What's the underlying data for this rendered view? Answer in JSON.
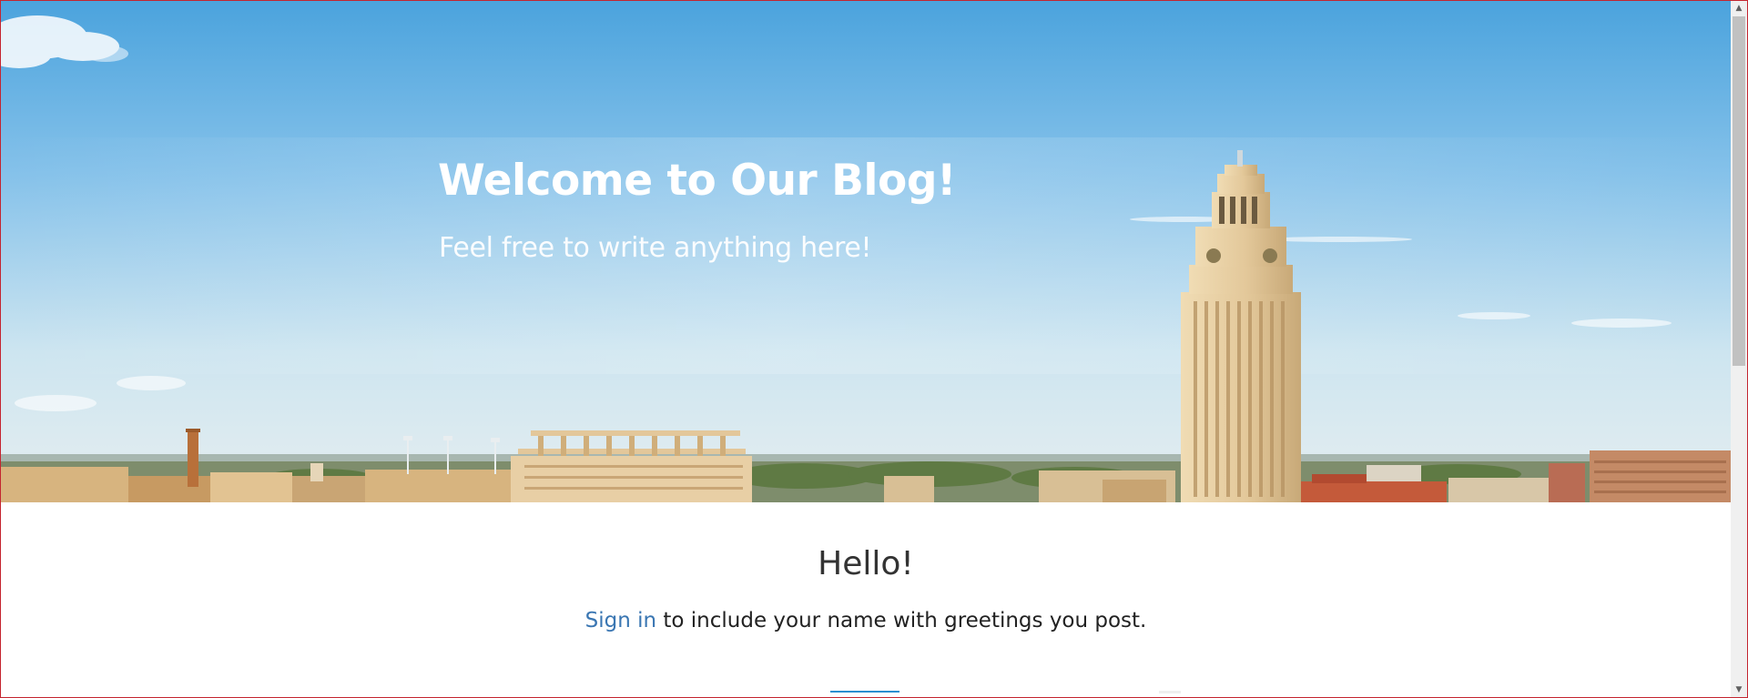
{
  "hero": {
    "title": "Welcome to Our Blog!",
    "subtitle": "Feel free to write anything here!"
  },
  "content": {
    "heading": "Hello!",
    "signin_link": "Sign in",
    "signin_suffix": " to include your name with greetings you post."
  },
  "scrollbar": {
    "up_glyph": "▲",
    "down_glyph": "▼"
  },
  "colors": {
    "sky_top": "#4aa2dc",
    "sky_bottom": "#e4eef0",
    "link": "#3a76b2",
    "divider": "#2a8fd0",
    "tower": "#e2cba0",
    "frame_border": "#c4242f"
  }
}
